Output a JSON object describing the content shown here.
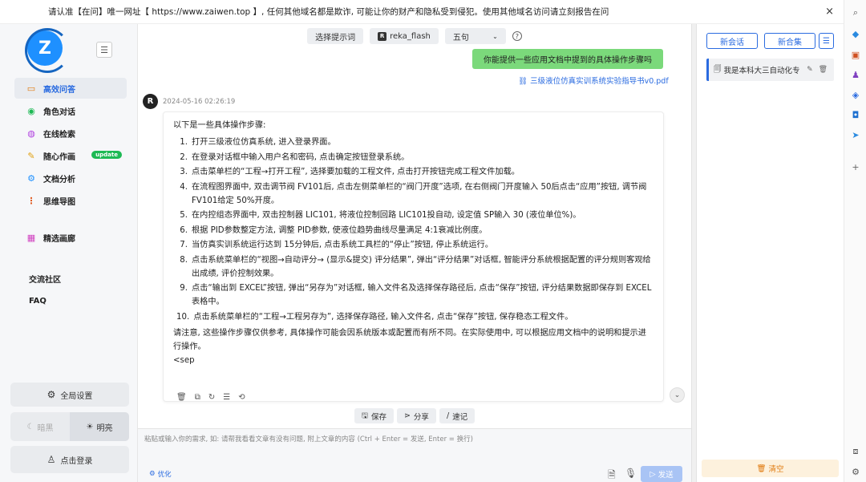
{
  "notice": {
    "text": "请认准【在问】唯一网址【 https://www.zaiwen.top 】, 任何其他域名都是欺诈, 可能让你的财产和隐私受到侵犯。使用其他域名访问请立刻报告在问",
    "close": "×"
  },
  "sidebar": {
    "logo_letter": "Z",
    "collapse_icon": "☰",
    "items": [
      {
        "label": "高效问答",
        "icon": "chat-icon",
        "glyph": "▭",
        "color": "#e07a10"
      },
      {
        "label": "角色对话",
        "icon": "role-icon",
        "glyph": "◉",
        "color": "#1db954"
      },
      {
        "label": "在线检索",
        "icon": "search-globe-icon",
        "glyph": "◍",
        "color": "#b040e0"
      },
      {
        "label": "随心作画",
        "icon": "palette-icon",
        "glyph": "✎",
        "color": "#e0a010",
        "badge": "update"
      },
      {
        "label": "文档分析",
        "icon": "doc-analyze-icon",
        "glyph": "⚙",
        "color": "#1e90ff"
      },
      {
        "label": "思维导图",
        "icon": "mindmap-icon",
        "glyph": "⋮",
        "color": "#e05a20"
      },
      {
        "label": "精选画廊",
        "icon": "gallery-icon",
        "glyph": "▦",
        "color": "#d040c0"
      }
    ],
    "plain": [
      "交流社区",
      "FAQ"
    ],
    "settings_label": "全局设置",
    "dark_label": "暗黑",
    "light_label": "明亮",
    "login_label": "点击登录"
  },
  "topbar": {
    "prompt_btn": "选择提示词",
    "model_btn": "reka_flash",
    "model_icon": "R",
    "sentence_select": "五句",
    "help": "?"
  },
  "chat": {
    "user_message": "你能提供一些应用文档中提到的具体操作步骤吗",
    "attachment": "三级液位仿真实训系统实验指导书v0.pdf",
    "bot_avatar": "R",
    "bot_time": "2024-05-16 02:26:19",
    "intro": "以下是一些具体操作步骤:",
    "steps": [
      {
        "n": "1.",
        "text": "打开三级液位仿真系统, 进入登录界面。"
      },
      {
        "n": "2.",
        "text": "在登录对话框中输入用户名和密码, 点击确定按钮登录系统。"
      },
      {
        "n": "3.",
        "text": "点击菜单栏的“工程→打开工程”, 选择要加载的工程文件, 点击打开按钮完成工程文件加载。"
      },
      {
        "n": "4.",
        "text": "在流程图界面中, 双击调节阀 FV101后, 点击左侧菜单栏的“阀门开度”选项, 在右侧阀门开度输入 50后点击“应用”按钮, 调节阀 FV101给定 50%开度。"
      },
      {
        "n": "5.",
        "text": "在内控组态界面中, 双击控制器 LIC101, 将液位控制回路 LIC101投自动, 设定值 SP输入 30 (液位单位%)。"
      },
      {
        "n": "6.",
        "text": "根据 PID参数整定方法, 调整 PID参数, 使液位趋势曲线尽量满足 4:1衰减比例度。"
      },
      {
        "n": "7.",
        "text": "当仿真实训系统运行达到 15分钟后, 点击系统工具栏的“停止”按钮, 停止系统运行。"
      },
      {
        "n": "8.",
        "text": "点击系统菜单栏的“视图→自动评分→ (显示&提交) 评分结果”, 弹出“评分结果”对话框, 智能评分系统根据配置的评分规则客观给出成绩, 评价控制效果。"
      },
      {
        "n": "9.",
        "text": "点击“输出到 EXCEL”按钮, 弹出“另存为”对话框, 输入文件名及选择保存路径后, 点击“保存”按钮, 评分结果数据即保存到 EXCEL表格中。"
      },
      {
        "n": "10.",
        "text": "点击系统菜单栏的“工程→工程另存为”, 选择保存路径, 输入文件名, 点击“保存”按钮, 保存稳态工程文件。"
      }
    ],
    "outro": "请注意, 这些操作步骤仅供参考, 具体操作可能会因系统版本或配置而有所不同。在实际使用中, 可以根据应用文档中的说明和提示进行操作。",
    "tail": "<sep"
  },
  "actions": {
    "save": "保存",
    "share": "分享",
    "note": "速记"
  },
  "input": {
    "placeholder": "粘贴或输入你的需求, 如: 请帮我看看文章有没有问题, 附上文章的内容 (Ctrl + Enter = 发送, Enter = 换行)",
    "optimize": "优化",
    "send": "发送"
  },
  "right_panel": {
    "new_chat": "新会话",
    "new_collection": "新合集",
    "conversation_title": "我是本科大三自动化专",
    "clear": "清空"
  }
}
